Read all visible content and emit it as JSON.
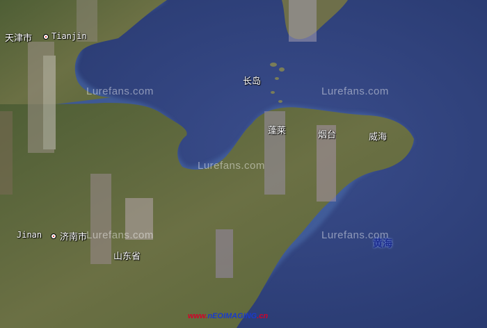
{
  "map": {
    "cities": [
      {
        "id": "tianjin",
        "zh": "天津市",
        "en": "Tianjin"
      },
      {
        "id": "jinan",
        "zh": "济南市",
        "en": "Jinan"
      }
    ],
    "places": {
      "changdao": "长岛",
      "penglai": "蓬莱",
      "yantai": "烟台",
      "weihai": "威海",
      "province": "山东省"
    },
    "sea": "黄海",
    "watermark": "Lurefans.com",
    "credit": {
      "prefix": "www.",
      "brand": "nEOIMAGING",
      "suffix": ".cn"
    },
    "colors": {
      "sea": "#2e3f7a",
      "land": "#5d6b3a",
      "label": "#ffffff",
      "credit_red": "#d4002a",
      "credit_blue": "#1a3acb"
    }
  }
}
